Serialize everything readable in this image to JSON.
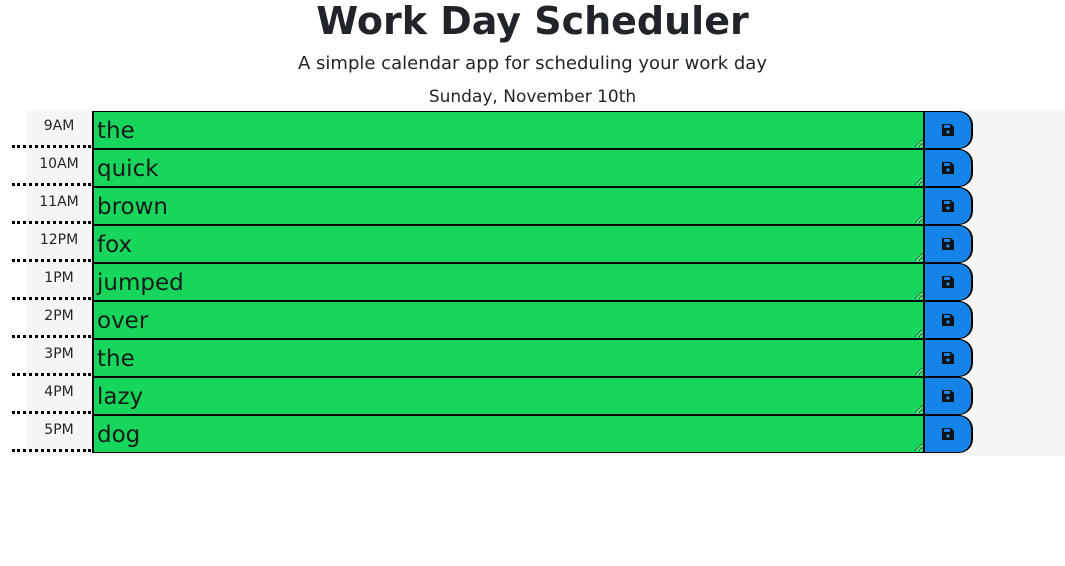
{
  "header": {
    "title": "Work Day Scheduler",
    "subtitle": "A simple calendar app for scheduling your work day",
    "current_day": "Sunday, November 10th"
  },
  "colors": {
    "present_row": "#16d65b",
    "save_button": "#1683e8",
    "container_bg": "#f5f5f5"
  },
  "save_icon": "floppy-disk-icon",
  "schedule": [
    {
      "hour": "9AM",
      "task": "the"
    },
    {
      "hour": "10AM",
      "task": "quick"
    },
    {
      "hour": "11AM",
      "task": "brown"
    },
    {
      "hour": "12PM",
      "task": "fox"
    },
    {
      "hour": "1PM",
      "task": "jumped"
    },
    {
      "hour": "2PM",
      "task": "over"
    },
    {
      "hour": "3PM",
      "task": "the"
    },
    {
      "hour": "4PM",
      "task": "lazy"
    },
    {
      "hour": "5PM",
      "task": "dog"
    }
  ]
}
